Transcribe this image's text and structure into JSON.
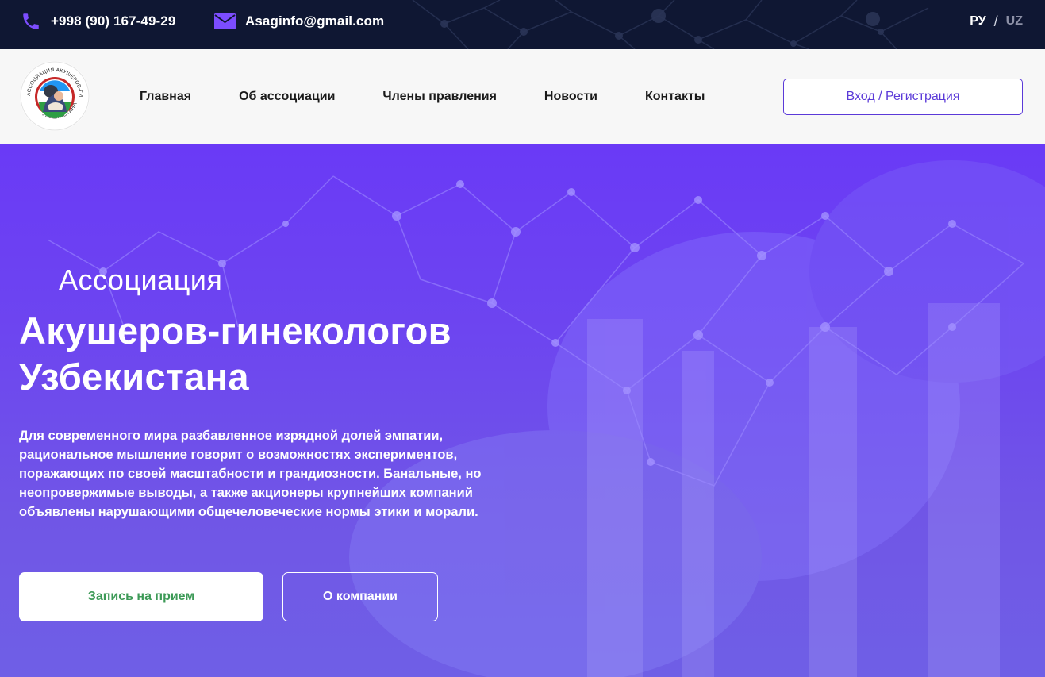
{
  "topbar": {
    "phone": "+998 (90) 167-49-29",
    "phone_icon": "phone-icon",
    "email": "Asaginfo@gmail.com",
    "email_icon": "mail-icon",
    "languages": {
      "active": "РУ",
      "separator": "/",
      "inactive": "UZ"
    }
  },
  "header": {
    "logo_text_top": "АССОЦИАЦИЯ АКУШЕРОВ-ГИНЕКОЛОГОВ",
    "logo_text_bottom": "УЗБЕКИСТАНА",
    "nav": [
      {
        "label": "Главная"
      },
      {
        "label": "Об ассоциации"
      },
      {
        "label": "Члены правления"
      },
      {
        "label": "Новости"
      },
      {
        "label": "Контакты"
      }
    ],
    "login_label": "Вход / Регистрация"
  },
  "hero": {
    "subtitle": "Ассоциация",
    "title_line1": "Акушеров-гинекологов",
    "title_line2": "Узбекистана",
    "description": "Для современного мира разбавленное изрядной долей эмпатии, рациональное мышление говорит о возможностях экспериментов, поражающих по своей масштабности и грандиозности. Банальные, но неопровержимые выводы, а также акционеры крупнейших компаний объявлены нарушающими общечеловеческие нормы этики и морали.",
    "primary_button": "Запись на прием",
    "secondary_button": "О компании"
  },
  "colors": {
    "topbar_bg": "#0f1733",
    "accent": "#5b3ad8",
    "icon_purple": "#7c4dff",
    "hero_bg": "#6a3af6",
    "primary_button_text": "#3d9a57"
  }
}
